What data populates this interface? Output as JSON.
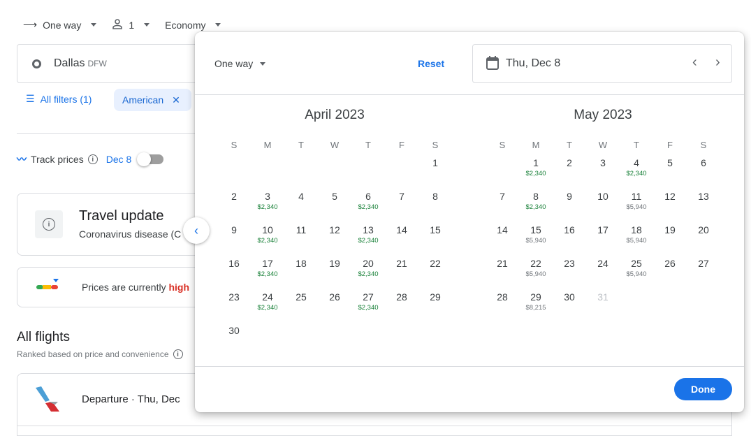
{
  "topbar": {
    "trip_type": "One way",
    "passengers": "1",
    "cabin": "Economy"
  },
  "search": {
    "origin_city": "Dallas",
    "origin_code": "DFW"
  },
  "filters": {
    "all_filters": "All filters (1)",
    "chip": "American"
  },
  "track": {
    "label": "Track prices",
    "date": "Dec 8",
    "enabled": false
  },
  "travel_update": {
    "title": "Travel update",
    "text": "Coronavirus disease (C"
  },
  "price_insight": {
    "text": "Prices are currently ",
    "level": "high"
  },
  "flights": {
    "title": "All flights",
    "subtitle": "Ranked based on price and convenience",
    "departure": "Departure",
    "dot": "·",
    "date": "Thu, Dec"
  },
  "popup": {
    "trip_type": "One way",
    "reset": "Reset",
    "date": "Thu, Dec 8",
    "done": "Done",
    "weekdays": [
      "S",
      "M",
      "T",
      "W",
      "T",
      "F",
      "S"
    ],
    "colors": {
      "low": "#188038",
      "typical": "#70757a"
    },
    "months": [
      {
        "title": "April 2023",
        "first_weekday": 6,
        "days": 30,
        "disabled": [],
        "prices": {
          "3": [
            "$2,340",
            "low"
          ],
          "6": [
            "$2,340",
            "low"
          ],
          "10": [
            "$2,340",
            "low"
          ],
          "13": [
            "$2,340",
            "low"
          ],
          "17": [
            "$2,340",
            "low"
          ],
          "20": [
            "$2,340",
            "low"
          ],
          "24": [
            "$2,340",
            "low"
          ],
          "27": [
            "$2,340",
            "low"
          ]
        }
      },
      {
        "title": "May 2023",
        "first_weekday": 1,
        "days": 31,
        "disabled": [
          31
        ],
        "prices": {
          "1": [
            "$2,340",
            "low"
          ],
          "4": [
            "$2,340",
            "low"
          ],
          "8": [
            "$2,340",
            "low"
          ],
          "11": [
            "$5,940",
            "typical"
          ],
          "15": [
            "$5,940",
            "typical"
          ],
          "18": [
            "$5,940",
            "typical"
          ],
          "22": [
            "$5,940",
            "typical"
          ],
          "25": [
            "$5,940",
            "typical"
          ],
          "29": [
            "$8,215",
            "typical"
          ]
        }
      }
    ]
  }
}
